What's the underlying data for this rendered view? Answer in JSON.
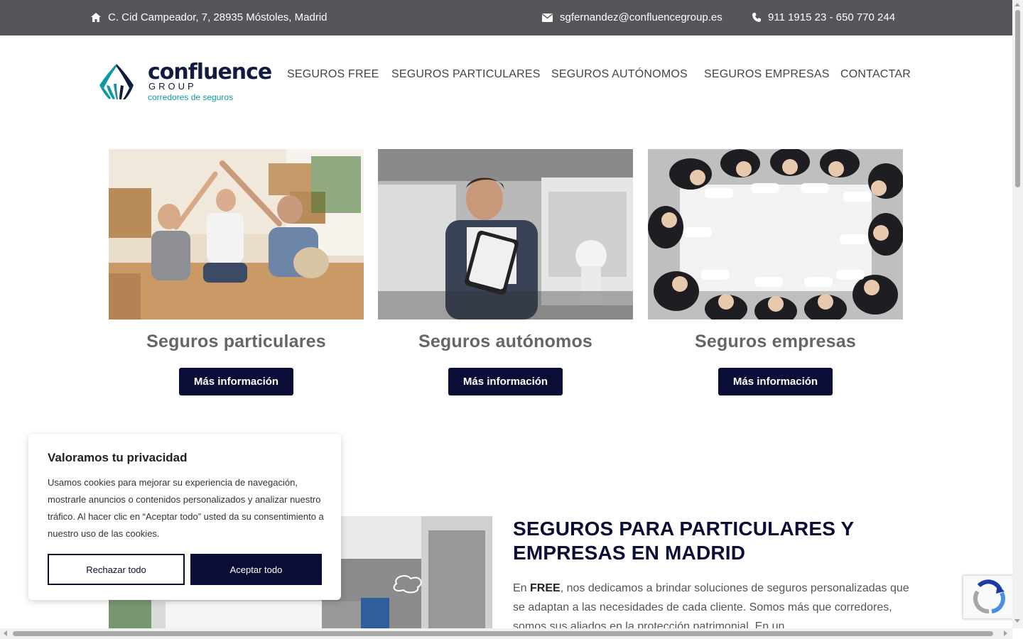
{
  "topbar": {
    "address": "C. Cid Campeador, 7, 28935 Móstoles, Madrid",
    "email": "sgfernandez@confluencegroup.es",
    "phone": "911 1915 23 - 650 770 244"
  },
  "logo": {
    "brand": "confluence",
    "group": "GROUP",
    "tagline": "corredores de seguros"
  },
  "nav": [
    "SEGUROS FREE",
    "SEGUROS PARTICULARES",
    "SEGUROS AUTÓNOMOS",
    "SEGUROS EMPRESAS",
    "CONTACTAR"
  ],
  "cards": [
    {
      "title": "Seguros particulares",
      "button": "Más información"
    },
    {
      "title": "Seguros autónomos",
      "button": "Más información"
    },
    {
      "title": "Seguros empresas",
      "button": "Más información"
    }
  ],
  "about": {
    "title": "SEGUROS PARA PARTICULARES Y EMPRESAS EN MADRID",
    "text_prefix": "En ",
    "text_bold": "FREE",
    "text_rest": ", nos dedicamos a brindar soluciones de seguros personalizadas que se adaptan a las necesidades de cada cliente. Somos más que corredores, somos sus aliados en la protección patrimonial. En un"
  },
  "cookie": {
    "title": "Valoramos tu privacidad",
    "text": "Usamos cookies para mejorar su experiencia de navegación, mostrarle anuncios o contenidos personalizados y analizar nuestro tráfico. Al hacer clic en “Aceptar todo” usted da su consentimiento a nuestro uso de las cookies.",
    "reject": "Rechazar todo",
    "accept": "Aceptar todo"
  },
  "colors": {
    "topbar": "#55555a",
    "navy": "#0a0d35",
    "teal": "#0e9ba0"
  }
}
